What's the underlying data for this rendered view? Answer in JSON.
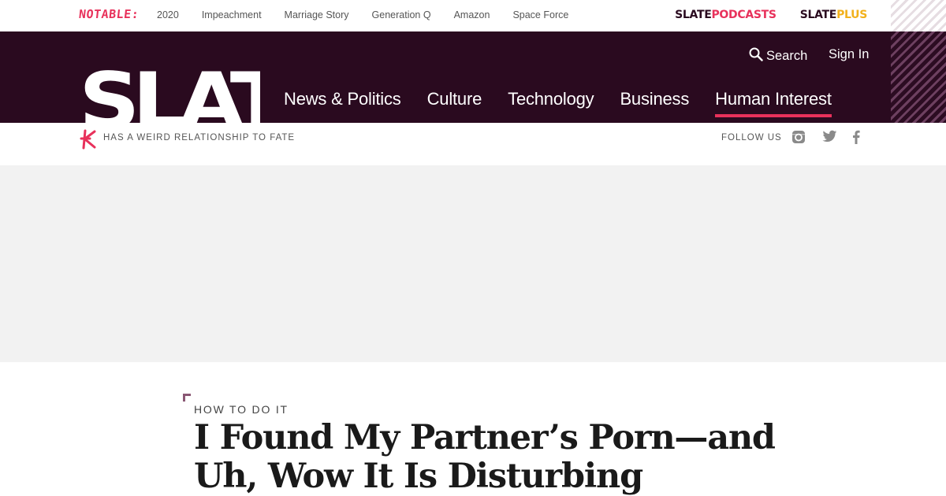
{
  "topbar": {
    "notable_label": "NOTABLE:",
    "topics": [
      "2020",
      "Impeachment",
      "Marriage Story",
      "Generation Q",
      "Amazon",
      "Space Force"
    ],
    "podcasts": {
      "slate": "SLATE",
      "suffix": "PODCASTS"
    },
    "plus": {
      "slate": "SLATE",
      "suffix": "PLUS"
    }
  },
  "header": {
    "logo": "SLATE",
    "search_label": "Search",
    "signin_label": "Sign In",
    "nav": [
      "News & Politics",
      "Culture",
      "Technology",
      "Business",
      "Human Interest"
    ],
    "active_nav": "Human Interest"
  },
  "subbar": {
    "tagline": "HAS A WEIRD RELATIONSHIP TO FATE",
    "follow_label": "FOLLOW US",
    "social_icons": [
      "instagram-icon",
      "twitter-icon",
      "facebook-icon"
    ]
  },
  "article": {
    "section": "HOW TO DO IT",
    "headline": "I Found My Partner’s Porn—and Uh, Wow It Is Disturbing"
  },
  "colors": {
    "header_bg": "#2a0a1f",
    "accent": "#e8315b",
    "plus_yellow": "#f2b11b",
    "ad_bg": "#f2f2f2"
  }
}
